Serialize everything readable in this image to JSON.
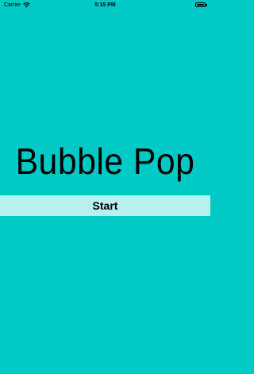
{
  "status_bar": {
    "carrier": "Carrier",
    "time": "5:15 PM",
    "wifi_icon": "wifi-icon",
    "battery_icon": "battery-icon"
  },
  "app": {
    "title": "Bubble Pop",
    "start_label": "Start"
  },
  "colors": {
    "background": "#00c9c6",
    "start_bar": "#b8efef"
  }
}
